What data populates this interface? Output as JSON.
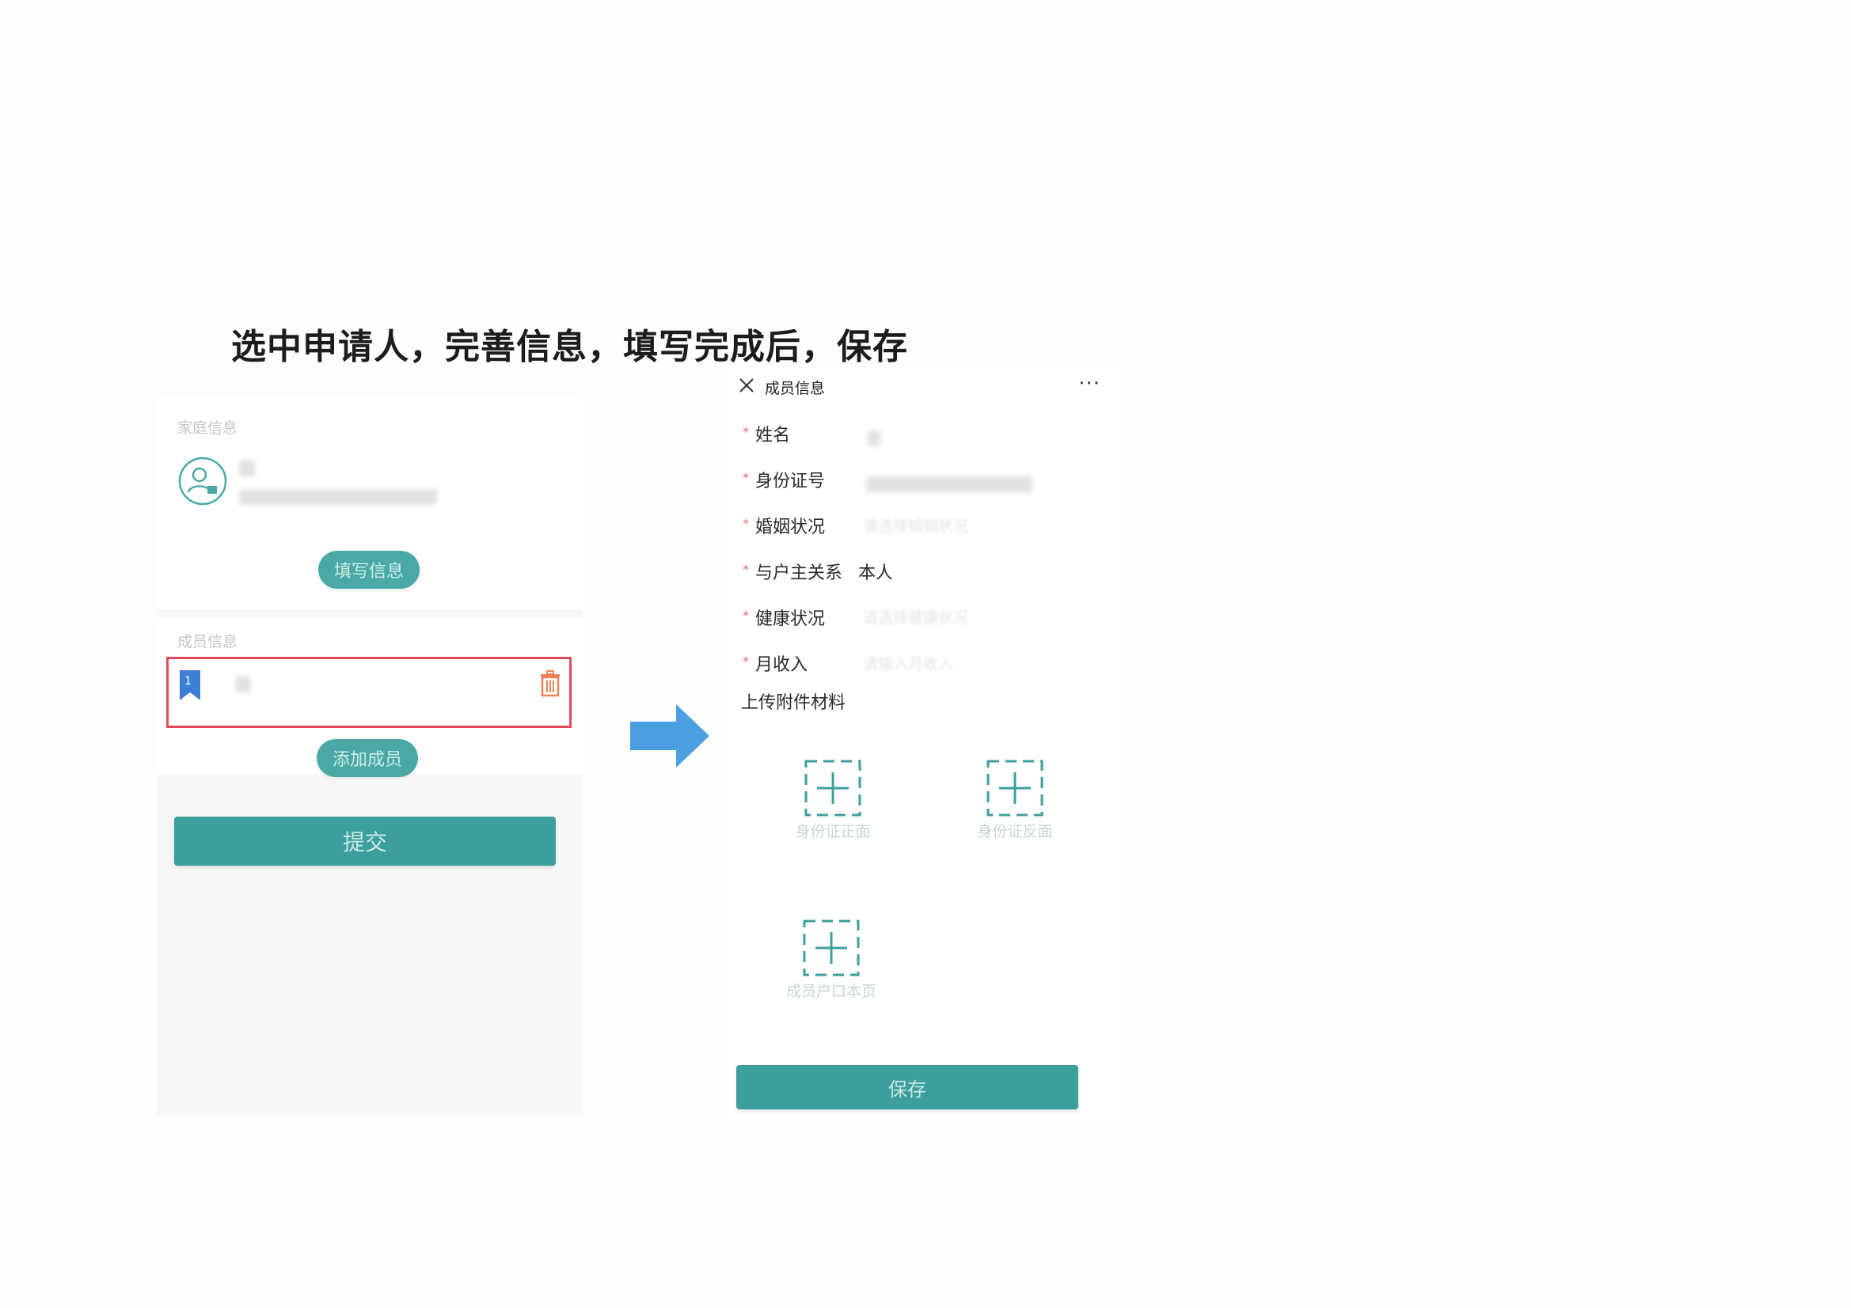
{
  "instruction": "选中申请人，完善信息，填写完成后，保存",
  "left": {
    "family_section_title": "家庭信息",
    "fill_info_button": "填写信息",
    "member_section_title": "成员信息",
    "member_index": "1",
    "add_member_button": "添加成员",
    "submit_button": "提交"
  },
  "right": {
    "header_title": "成员信息",
    "more": "···",
    "fields": [
      {
        "required": "*",
        "label": "姓名",
        "value": "",
        "placeholder": ""
      },
      {
        "required": "*",
        "label": "身份证号",
        "value": "",
        "placeholder": ""
      },
      {
        "required": "*",
        "label": "婚姻状况",
        "value": "",
        "placeholder": "请选择婚姻状况"
      },
      {
        "required": "*",
        "label": "与户主关系",
        "value": "本人",
        "placeholder": ""
      },
      {
        "required": "*",
        "label": "健康状况",
        "value": "",
        "placeholder": "请选择健康状况"
      },
      {
        "required": "*",
        "label": "月收入",
        "value": "",
        "placeholder": "请输入月收入"
      }
    ],
    "upload_title": "上传附件材料",
    "uploads": [
      "身份证正面",
      "身份证反面",
      "成员户口本页"
    ],
    "save_button": "保存"
  },
  "colors": {
    "accent": "#3c9f9c",
    "highlight_border": "#e04a5a",
    "arrow": "#4a9fe0",
    "required_mark": "#e46b6b"
  }
}
